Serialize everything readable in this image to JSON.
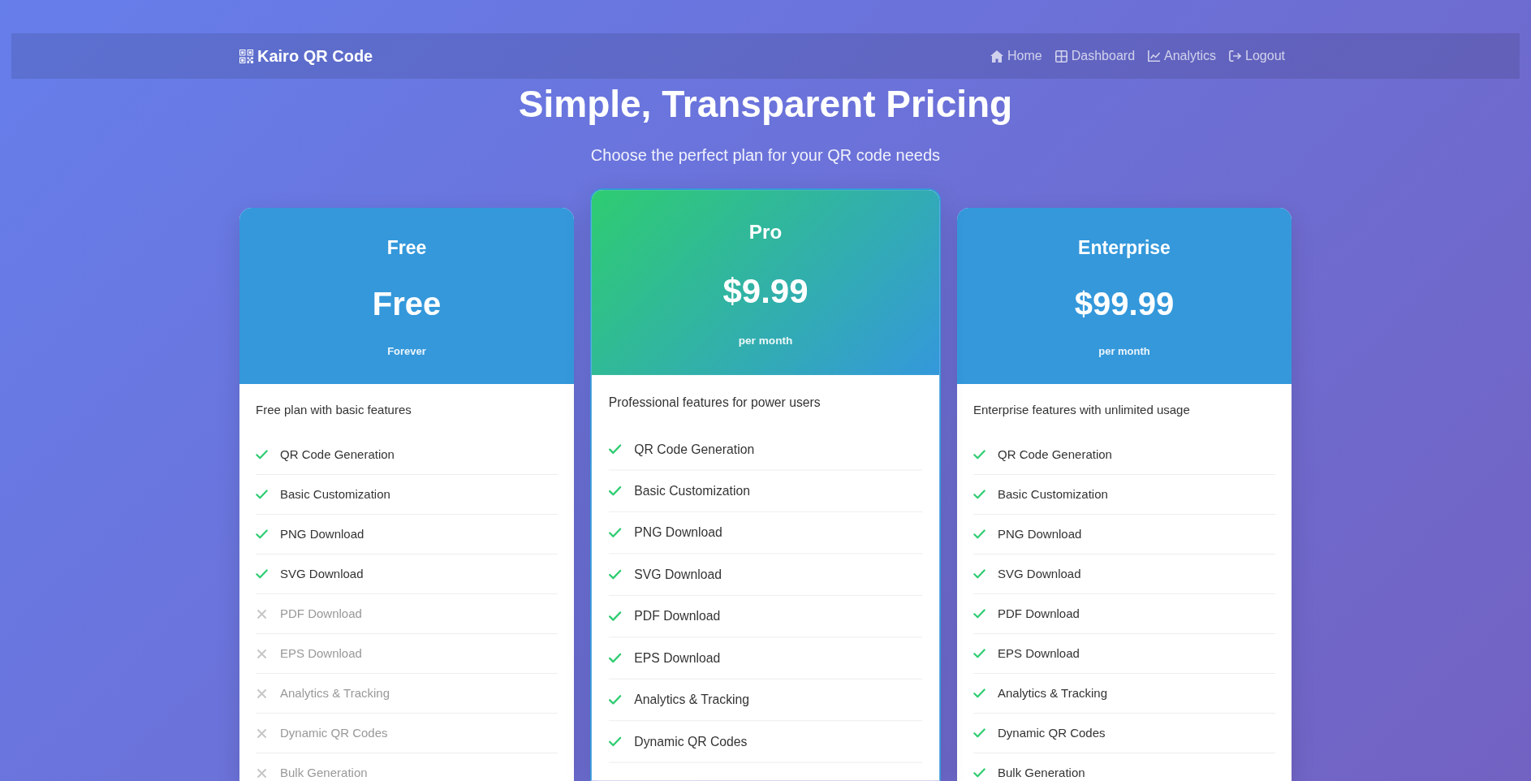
{
  "navbar": {
    "brand": "Kairo QR Code",
    "links": [
      "Home",
      "Dashboard",
      "Analytics",
      "Logout"
    ]
  },
  "hero": {
    "title": "Simple, Transparent Pricing",
    "subtitle": "Choose the perfect plan for your QR code needs"
  },
  "plans": [
    {
      "name": "Free",
      "price": "Free",
      "period": "Forever",
      "featured": false,
      "description": "Free plan with basic features",
      "features": [
        {
          "label": "QR Code Generation",
          "included": true
        },
        {
          "label": "Basic Customization",
          "included": true
        },
        {
          "label": "PNG Download",
          "included": true
        },
        {
          "label": "SVG Download",
          "included": true
        },
        {
          "label": "PDF Download",
          "included": false
        },
        {
          "label": "EPS Download",
          "included": false
        },
        {
          "label": "Analytics & Tracking",
          "included": false
        },
        {
          "label": "Dynamic QR Codes",
          "included": false
        },
        {
          "label": "Bulk Generation",
          "included": false
        }
      ]
    },
    {
      "name": "Pro",
      "price": "$9.99",
      "period": "per month",
      "featured": true,
      "description": "Professional features for power users",
      "features": [
        {
          "label": "QR Code Generation",
          "included": true
        },
        {
          "label": "Basic Customization",
          "included": true
        },
        {
          "label": "PNG Download",
          "included": true
        },
        {
          "label": "SVG Download",
          "included": true
        },
        {
          "label": "PDF Download",
          "included": true
        },
        {
          "label": "EPS Download",
          "included": true
        },
        {
          "label": "Analytics & Tracking",
          "included": true
        },
        {
          "label": "Dynamic QR Codes",
          "included": true
        }
      ]
    },
    {
      "name": "Enterprise",
      "price": "$99.99",
      "period": "per month",
      "featured": false,
      "description": "Enterprise features with unlimited usage",
      "features": [
        {
          "label": "QR Code Generation",
          "included": true
        },
        {
          "label": "Basic Customization",
          "included": true
        },
        {
          "label": "PNG Download",
          "included": true
        },
        {
          "label": "SVG Download",
          "included": true
        },
        {
          "label": "PDF Download",
          "included": true
        },
        {
          "label": "EPS Download",
          "included": true
        },
        {
          "label": "Analytics & Tracking",
          "included": true
        },
        {
          "label": "Dynamic QR Codes",
          "included": true
        },
        {
          "label": "Bulk Generation",
          "included": true
        }
      ]
    }
  ]
}
